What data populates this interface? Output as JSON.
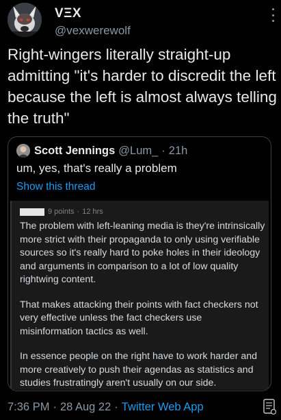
{
  "tweet": {
    "display_name": "VΞX",
    "handle": "@vexwerewolf",
    "text": "Right-wingers literally straight-up admitting \"it's harder to discredit the left because the left is almost always telling the truth\"",
    "more_icon": "more-vertical-icon"
  },
  "quote": {
    "name": "Scott Jennings",
    "handle": "@Lum_",
    "dot": "·",
    "time": "21h",
    "text": "um, yes, that's really a problem",
    "show_thread": "Show this thread"
  },
  "reddit": {
    "points": "9 points",
    "dot": "·",
    "age": "12 hrs",
    "paragraphs": [
      "The problem with left-leaning media is they're intrinsically more strict with their propaganda to only using verifiable sources so it's really hard to poke holes in their ideology and arguments in comparison to a lot of low quality rightwing content.",
      "That makes attacking their points with fact checkers not very effective unless the fact checkers use misinformation tactics as well.",
      "In essence people on the right have to work harder and more creatively to push their agendas as statistics and studies frustratingly aren't usually on our side."
    ]
  },
  "footer": {
    "time": "7:36 PM",
    "dot1": "·",
    "date": "28 Aug 22",
    "dot2": "·",
    "source": "Twitter Web App"
  },
  "colors": {
    "background": "#000000",
    "text": "#e7e9ea",
    "muted": "#8b98a5",
    "link": "#1d9bf0",
    "reddit_bg": "#1a1a1b"
  }
}
